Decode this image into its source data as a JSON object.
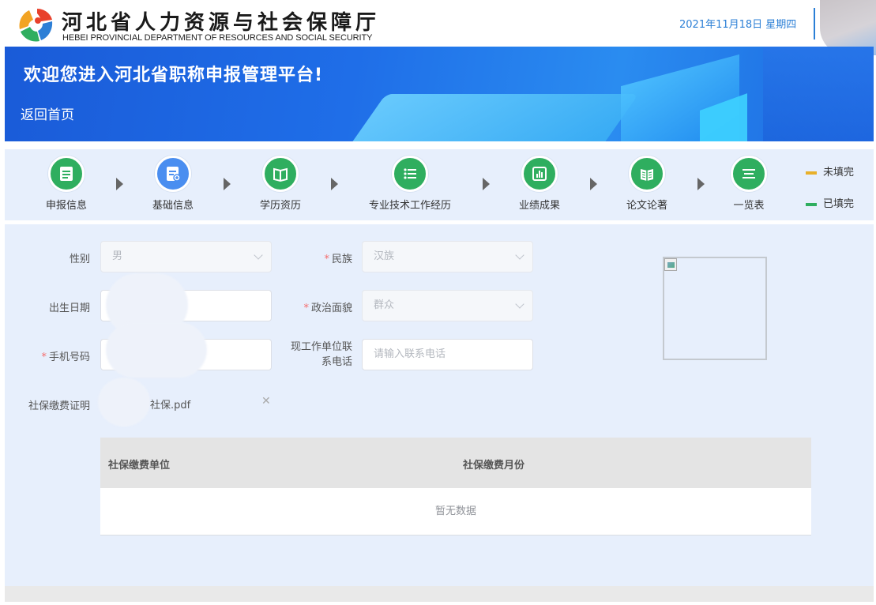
{
  "header": {
    "org_name_cn": "河北省人力资源与社会保障厅",
    "org_name_en": "HEBEI PROVINCIAL DEPARTMENT OF RESOURCES AND SOCIAL SECURITY",
    "date": "2021年11月18日 星期四"
  },
  "banner": {
    "title": "欢迎您进入河北省职称申报管理平台!",
    "back_link": "返回首页"
  },
  "steps": [
    {
      "label": "申报信息",
      "icon": "report-icon"
    },
    {
      "label": "基础信息",
      "icon": "edit-doc-icon"
    },
    {
      "label": "学历资历",
      "icon": "book-icon"
    },
    {
      "label": "专业技术工作经历",
      "icon": "list-icon"
    },
    {
      "label": "业绩成果",
      "icon": "bar-chart-icon"
    },
    {
      "label": "论文论著",
      "icon": "open-book-icon"
    },
    {
      "label": "一览表",
      "icon": "menu-icon"
    }
  ],
  "legend": {
    "unfilled": "未填完",
    "filled": "已填完",
    "unfilled_color": "#e8b02a",
    "filled_color": "#2fae5f"
  },
  "form": {
    "gender_label": "性别",
    "gender_value": "男",
    "ethnicity_label": "民族",
    "ethnicity_value": "汉族",
    "birth_label": "出生日期",
    "political_label": "政治面貌",
    "political_value": "群众",
    "phone_label": "手机号码",
    "work_phone_label": "现工作单位联系电话",
    "work_phone_placeholder": "请输入联系电话",
    "social_cert_label": "社保缴费证明",
    "social_cert_file": "社保.pdf"
  },
  "table": {
    "col_unit": "社保缴费单位",
    "col_month": "社保缴费月份",
    "empty_text": "暂无数据"
  }
}
